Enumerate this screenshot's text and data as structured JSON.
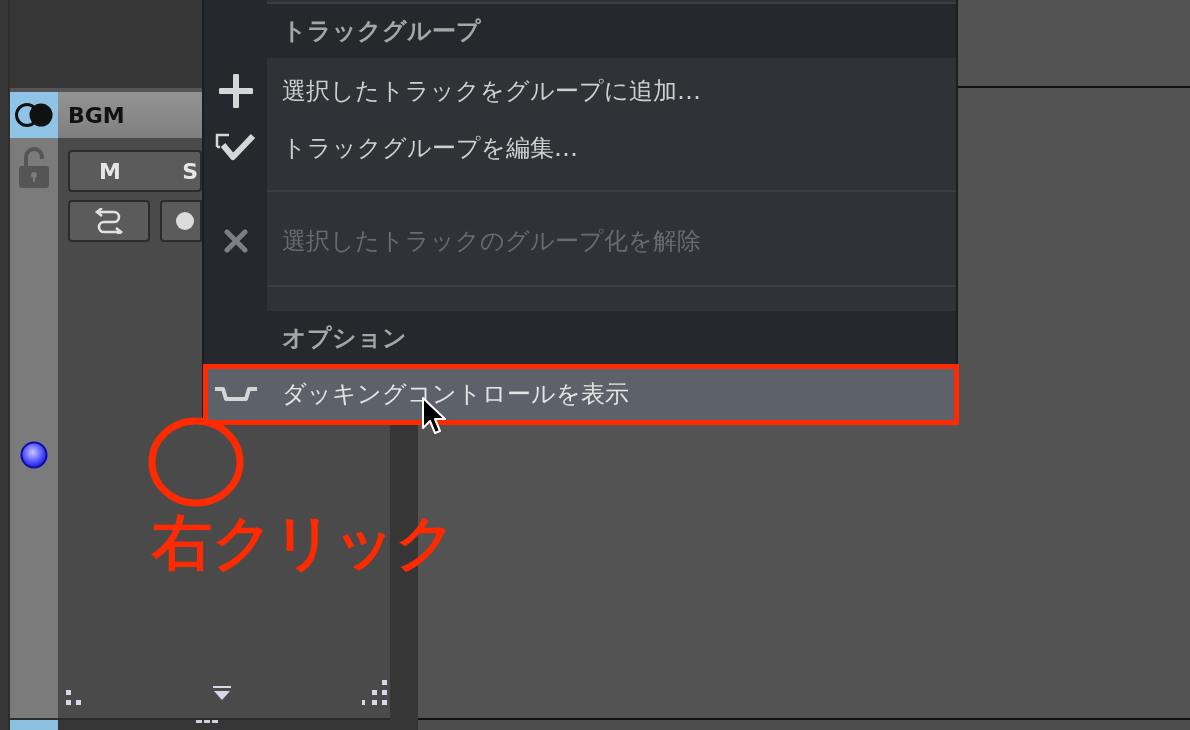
{
  "track": {
    "name": "BGM",
    "buttons": [
      {
        "label": "M"
      },
      {
        "label": "S"
      }
    ]
  },
  "context_menu": {
    "sections": [
      {
        "title": "トラックグループ",
        "groups": [
          {
            "items": [
              {
                "kind": "add",
                "label": "選択したトラックをグループに追加…",
                "disabled": false,
                "highlighted": false,
                "framed": false
              },
              {
                "kind": "edit",
                "label": "トラックグループを編集…",
                "disabled": false,
                "highlighted": false,
                "framed": false
              }
            ]
          },
          {
            "items": [
              {
                "kind": "remove",
                "label": "選択したトラックのグループ化を解除",
                "disabled": true,
                "highlighted": false,
                "framed": false
              }
            ]
          }
        ]
      },
      {
        "title": "オプション",
        "groups": [
          {
            "items": [
              {
                "kind": "ducking",
                "label": "ダッキングコントロールを表示",
                "disabled": false,
                "highlighted": true,
                "framed": true
              }
            ]
          }
        ]
      }
    ]
  },
  "annotation": {
    "text": "右クリック"
  }
}
